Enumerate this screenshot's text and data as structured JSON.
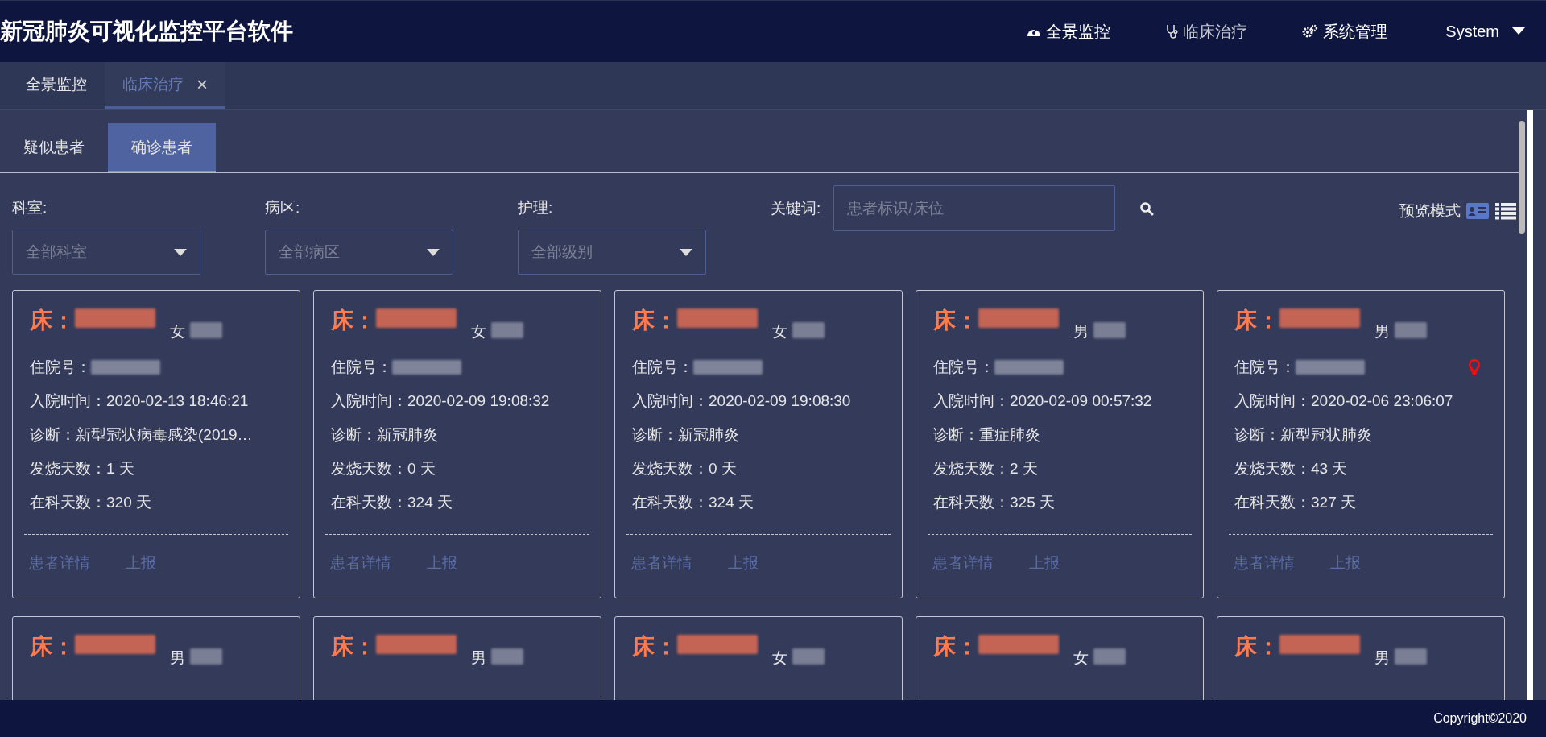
{
  "app_title": "新冠肺炎可视化监控平台软件",
  "nav": [
    {
      "label": "全景监控",
      "selected": false
    },
    {
      "label": "临床治疗",
      "selected": true
    },
    {
      "label": "系统管理",
      "selected": false
    }
  ],
  "user_menu": {
    "label": "System"
  },
  "page_tabs": [
    {
      "label": "全景监控",
      "selected": false
    },
    {
      "label": "临床治疗",
      "selected": true
    }
  ],
  "close_glyph": "×",
  "sub_tabs": [
    {
      "label": "疑似患者",
      "selected": false
    },
    {
      "label": "确诊患者",
      "selected": true
    }
  ],
  "filters": [
    {
      "label": "科室:",
      "placeholder": "全部科室"
    },
    {
      "label": "病区:",
      "placeholder": "全部病区"
    },
    {
      "label": "护理:",
      "placeholder": "全部级别"
    }
  ],
  "keyword": {
    "label": "关键词:",
    "placeholder": "患者标识/床位"
  },
  "preview": {
    "label": "预览模式",
    "modes": [
      {
        "kind": "card",
        "selected": true
      },
      {
        "kind": "list",
        "selected": false
      }
    ]
  },
  "cards": [
    {
      "bed_label": "床：",
      "gender": "女",
      "alert": false,
      "fields": [
        {
          "label": "住院号："
        },
        {
          "label": "入院时间：",
          "value": "2020-02-13 18:46:21"
        },
        {
          "label": "诊断：",
          "value": "新型冠状病毒感染(2019…"
        },
        {
          "label": "发烧天数：",
          "value": "1 天"
        },
        {
          "label": "在科天数：",
          "value": "320 天"
        }
      ],
      "actions": [
        "患者详情",
        "上报"
      ]
    },
    {
      "bed_label": "床：",
      "gender": "女",
      "alert": false,
      "fields": [
        {
          "label": "住院号："
        },
        {
          "label": "入院时间：",
          "value": "2020-02-09 19:08:32"
        },
        {
          "label": "诊断：",
          "value": "新冠肺炎"
        },
        {
          "label": "发烧天数：",
          "value": "0 天"
        },
        {
          "label": "在科天数：",
          "value": "324 天"
        }
      ],
      "actions": [
        "患者详情",
        "上报"
      ]
    },
    {
      "bed_label": "床：",
      "gender": "女",
      "alert": false,
      "fields": [
        {
          "label": "住院号："
        },
        {
          "label": "入院时间：",
          "value": "2020-02-09 19:08:30"
        },
        {
          "label": "诊断：",
          "value": "新冠肺炎"
        },
        {
          "label": "发烧天数：",
          "value": "0 天"
        },
        {
          "label": "在科天数：",
          "value": "324 天"
        }
      ],
      "actions": [
        "患者详情",
        "上报"
      ]
    },
    {
      "bed_label": "床：",
      "gender": "男",
      "alert": false,
      "fields": [
        {
          "label": "住院号："
        },
        {
          "label": "入院时间：",
          "value": "2020-02-09 00:57:32"
        },
        {
          "label": "诊断：",
          "value": "重症肺炎"
        },
        {
          "label": "发烧天数：",
          "value": "2 天"
        },
        {
          "label": "在科天数：",
          "value": "325 天"
        }
      ],
      "actions": [
        "患者详情",
        "上报"
      ]
    },
    {
      "bed_label": "床：",
      "gender": "男",
      "alert": true,
      "fields": [
        {
          "label": "住院号："
        },
        {
          "label": "入院时间：",
          "value": "2020-02-06 23:06:07"
        },
        {
          "label": "诊断：",
          "value": "新型冠状肺炎"
        },
        {
          "label": "发烧天数：",
          "value": "43 天"
        },
        {
          "label": "在科天数：",
          "value": "327 天"
        }
      ],
      "actions": [
        "患者详情",
        "上报"
      ]
    },
    {
      "bed_label": "床：",
      "gender": "男"
    },
    {
      "bed_label": "床：",
      "gender": "男"
    },
    {
      "bed_label": "床：",
      "gender": "女"
    },
    {
      "bed_label": "床：",
      "gender": "女"
    },
    {
      "bed_label": "床：",
      "gender": "男"
    }
  ],
  "footer": "Copyright©2020"
}
